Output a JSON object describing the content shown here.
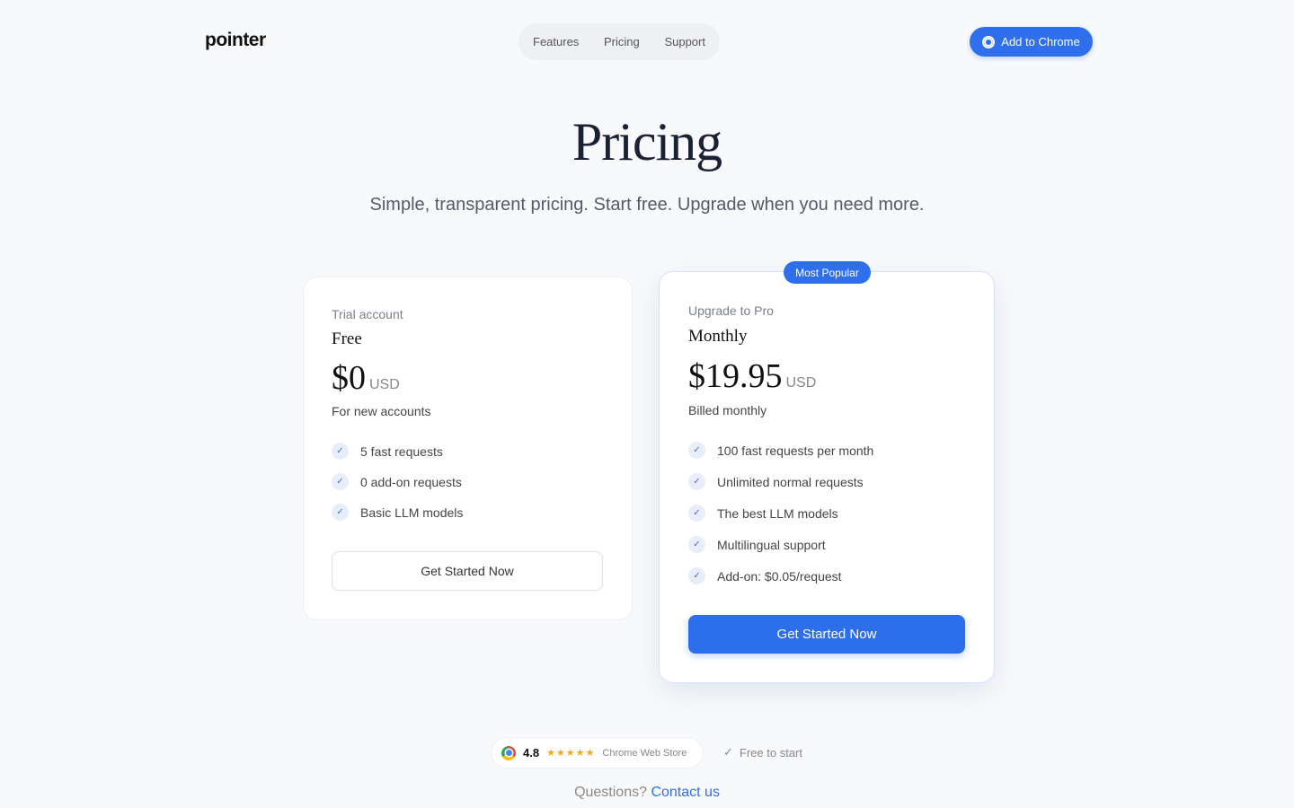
{
  "header": {
    "logo": "pointer",
    "nav": [
      "Features",
      "Pricing",
      "Support"
    ],
    "cta_label": "Add to Chrome"
  },
  "hero": {
    "title": "Pricing",
    "subtitle": "Simple, transparent pricing. Start free. Upgrade when you need more."
  },
  "plans": [
    {
      "label": "Trial account",
      "name": "Free",
      "price": "$0",
      "currency": "USD",
      "note": "For new accounts",
      "features": [
        "5 fast requests",
        "0 add-on requests",
        "Basic LLM models"
      ],
      "button": "Get Started Now"
    },
    {
      "badge": "Most Popular",
      "label": "Upgrade to Pro",
      "name": "Monthly",
      "price": "$19.95",
      "currency": "USD",
      "note": "Billed monthly",
      "features": [
        "100 fast requests per month",
        "Unlimited normal requests",
        "The best LLM models",
        "Multilingual support",
        "Add-on: $0.05/request"
      ],
      "button": "Get Started Now"
    }
  ],
  "footer": {
    "rating": "4.8",
    "stars": "★★★★★",
    "store": "Chrome Web Store",
    "free_start": "Free to start",
    "question": "Questions?",
    "contact": "Contact us"
  },
  "icons": {
    "check": "check-icon",
    "chrome": "chrome-icon",
    "star": "star-icon"
  },
  "colors": {
    "accent": "#2f6fec",
    "background": "#f8f9fb",
    "star": "#f5a623"
  }
}
